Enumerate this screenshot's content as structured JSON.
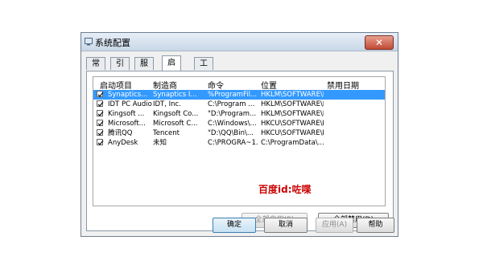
{
  "window": {
    "title": "系统配置",
    "close_glyph": "✕"
  },
  "tabs": [
    "常规",
    "引导",
    "服务",
    "启动",
    "工具"
  ],
  "active_tab_index": 3,
  "table": {
    "columns": [
      "启动项目",
      "制造商",
      "命令",
      "位置",
      "禁用日期"
    ],
    "rows": [
      {
        "checked": true,
        "selected": true,
        "item": "Synaptics...",
        "maker": "Synaptics I...",
        "command": "%ProgramFil...",
        "location": "HKLM\\SOFTWARE\\M...",
        "disabled_date": ""
      },
      {
        "checked": true,
        "selected": false,
        "item": "IDT PC Audio",
        "maker": "IDT, Inc.",
        "command": "C:\\Program ...",
        "location": "HKLM\\SOFTWARE\\M...",
        "disabled_date": ""
      },
      {
        "checked": true,
        "selected": false,
        "item": "Kingsoft ...",
        "maker": "Kingsoft Co...",
        "command": "\"D:\\Program...",
        "location": "HKLM\\SOFTWARE\\M...",
        "disabled_date": ""
      },
      {
        "checked": true,
        "selected": false,
        "item": "Microsoft...",
        "maker": "Microsoft C...",
        "command": "C:\\Windows\\...",
        "location": "HKCU\\SOFTWARE\\M...",
        "disabled_date": ""
      },
      {
        "checked": true,
        "selected": false,
        "item": "腾讯QQ",
        "maker": "Tencent",
        "command": "\"D:\\QQ\\Bin\\...",
        "location": "HKCU\\SOFTWARE\\M...",
        "disabled_date": ""
      },
      {
        "checked": true,
        "selected": false,
        "item": "AnyDesk",
        "maker": "未知",
        "command": "C:\\PROGRA~1...",
        "location": "C:\\ProgramData\\...",
        "disabled_date": ""
      }
    ]
  },
  "watermark": "百度id:咗喋",
  "buttons": {
    "enable_all": "全部启用(E)",
    "disable_all": "全部禁用(D)",
    "ok": "确定",
    "cancel": "取消",
    "apply": "应用(A)",
    "help": "帮助"
  },
  "colors": {
    "selection": "#3399ff",
    "watermark": "#cc0000"
  }
}
